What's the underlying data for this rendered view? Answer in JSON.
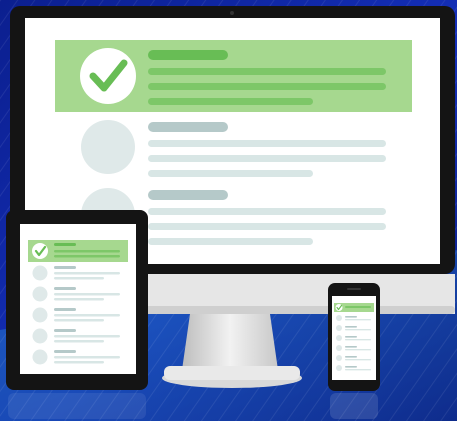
{
  "scene": {
    "colors": {
      "bg_dark": "#0a1a78",
      "bg_light": "#1f4bd6",
      "floor_light": "#2a8ad6",
      "bezel": "#141414",
      "screen": "#ffffff",
      "green_band": "#a6d88f",
      "green_bar": "#68bd55",
      "green_bar_light": "#80c96b",
      "row_circle": "#dfe9e9",
      "row_bar_dark": "#b5c9c9",
      "row_bar_light": "#d8e6e5",
      "stand": "#d6d6d6",
      "check": "#68bd55"
    },
    "icons": {
      "check": "check-circle-icon"
    }
  }
}
